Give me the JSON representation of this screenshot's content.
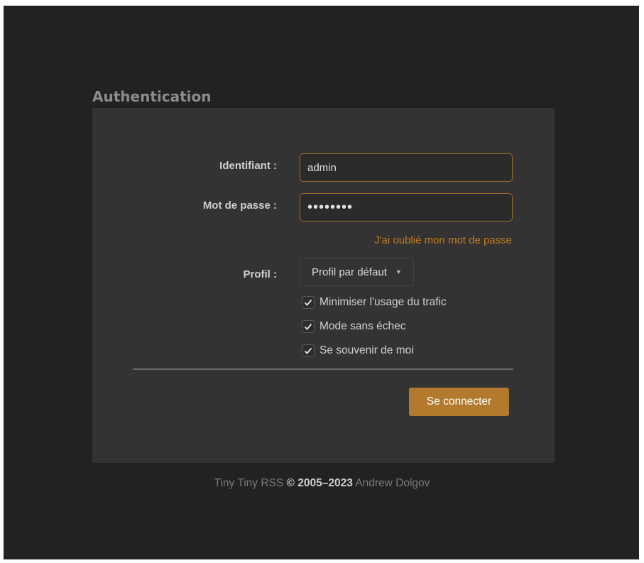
{
  "auth": {
    "heading": "Authentication",
    "login_label": "Identifiant :",
    "login_value": "admin",
    "password_label": "Mot de passe :",
    "password_value": "password",
    "forgot_link": "J'ai oublié mon mot de passe",
    "profile_label": "Profil :",
    "profile_selected": "Profil par défaut",
    "options": {
      "bw_limit": {
        "label": "Minimiser l'usage du trafic",
        "checked": true
      },
      "safe_mode": {
        "label": "Mode sans échec",
        "checked": true
      },
      "remember_me": {
        "label": "Se souvenir de moi",
        "checked": true
      }
    },
    "submit_label": "Se connecter"
  },
  "footer": {
    "app_name": "Tiny Tiny RSS",
    "copyright": "© 2005–2023",
    "author": "Andrew Dolgov"
  },
  "colors": {
    "background": "#222222",
    "panel": "#333333",
    "accent": "#b3792c",
    "link": "#c37b1e",
    "input_border": "#9a6d2c"
  }
}
